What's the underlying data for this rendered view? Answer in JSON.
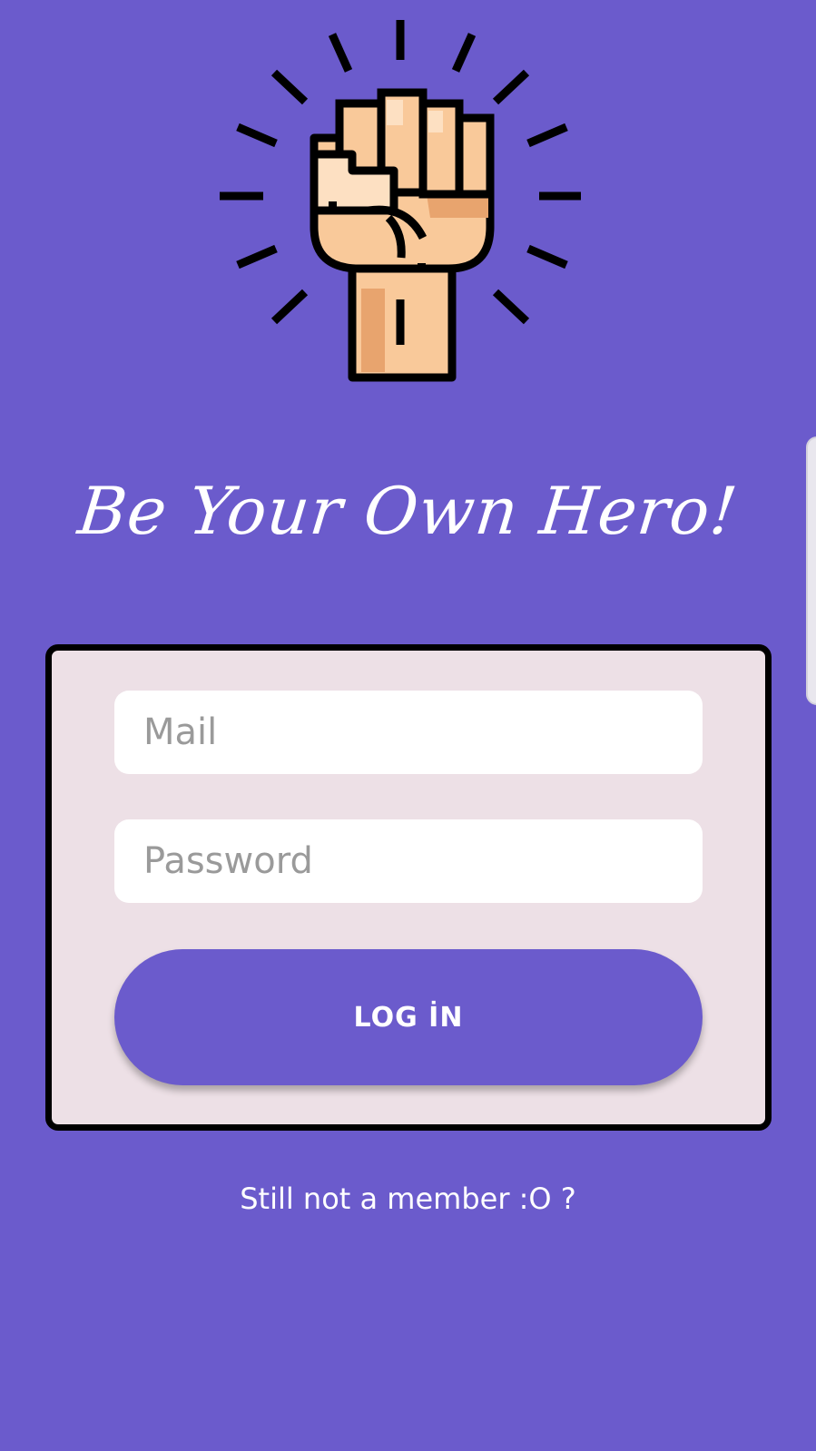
{
  "brand": {
    "logo_icon": "raised-fist-icon",
    "headline": "Be Your Own Hero!"
  },
  "login_form": {
    "mail_placeholder": "Mail",
    "password_placeholder": "Password",
    "login_label": "LOG İN"
  },
  "signup": {
    "prompt": "Still not a member :O ?"
  },
  "colors": {
    "background": "#6b5bcc",
    "card_background": "#ede0e6",
    "button": "#6b5bcc",
    "skin": "#f9c99a",
    "skin_shadow": "#e8a46e",
    "outline": "#000000"
  }
}
